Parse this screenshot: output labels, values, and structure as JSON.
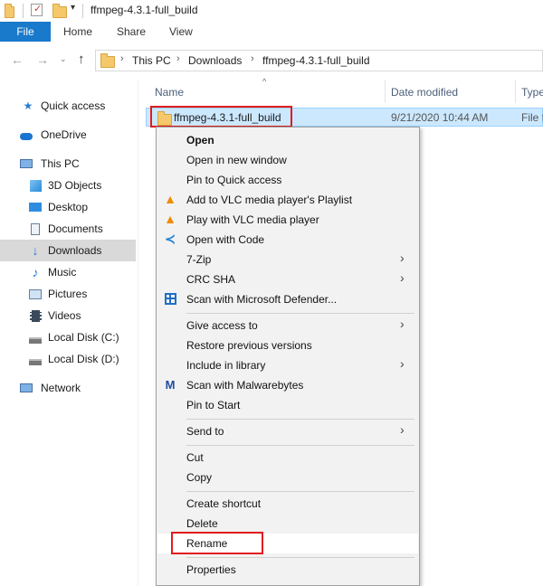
{
  "window": {
    "title": "ffmpeg-4.3.1-full_build"
  },
  "ribbon": {
    "tabs": [
      "File",
      "Home",
      "Share",
      "View"
    ]
  },
  "address": {
    "crumbs": [
      "This PC",
      "Downloads",
      "ffmpeg-4.3.1-full_build"
    ]
  },
  "sidebar": {
    "items": [
      {
        "label": "Quick access",
        "icon": "star-icon"
      },
      {
        "label": "OneDrive",
        "icon": "cloud-icon"
      },
      {
        "label": "This PC",
        "icon": "computer-icon"
      },
      {
        "label": "3D Objects",
        "icon": "cube-icon"
      },
      {
        "label": "Desktop",
        "icon": "desktop-icon"
      },
      {
        "label": "Documents",
        "icon": "document-icon"
      },
      {
        "label": "Downloads",
        "icon": "download-icon"
      },
      {
        "label": "Music",
        "icon": "music-icon"
      },
      {
        "label": "Pictures",
        "icon": "picture-icon"
      },
      {
        "label": "Videos",
        "icon": "video-icon"
      },
      {
        "label": "Local Disk (C:)",
        "icon": "drive-icon"
      },
      {
        "label": "Local Disk (D:)",
        "icon": "drive-icon"
      },
      {
        "label": "Network",
        "icon": "network-icon"
      }
    ]
  },
  "filelist": {
    "columns": [
      "Name",
      "Date modified",
      "Type"
    ],
    "rows": [
      {
        "name": "ffmpeg-4.3.1-full_build",
        "date": "9/21/2020 10:44 AM",
        "type": "File f"
      }
    ]
  },
  "context_menu": {
    "items": [
      "Open",
      "Open in new window",
      "Pin to Quick access",
      "Add to VLC media player's Playlist",
      "Play with VLC media player",
      "Open with Code",
      "7-Zip",
      "CRC SHA",
      "Scan with Microsoft Defender...",
      "Give access to",
      "Restore previous versions",
      "Include in library",
      "Scan with Malwarebytes",
      "Pin to Start",
      "Send to",
      "Cut",
      "Copy",
      "Create shortcut",
      "Delete",
      "Rename",
      "Properties"
    ]
  },
  "colors": {
    "accent": "#1979ca",
    "selection": "#cce8ff",
    "highlight_box": "#e21b1b"
  }
}
